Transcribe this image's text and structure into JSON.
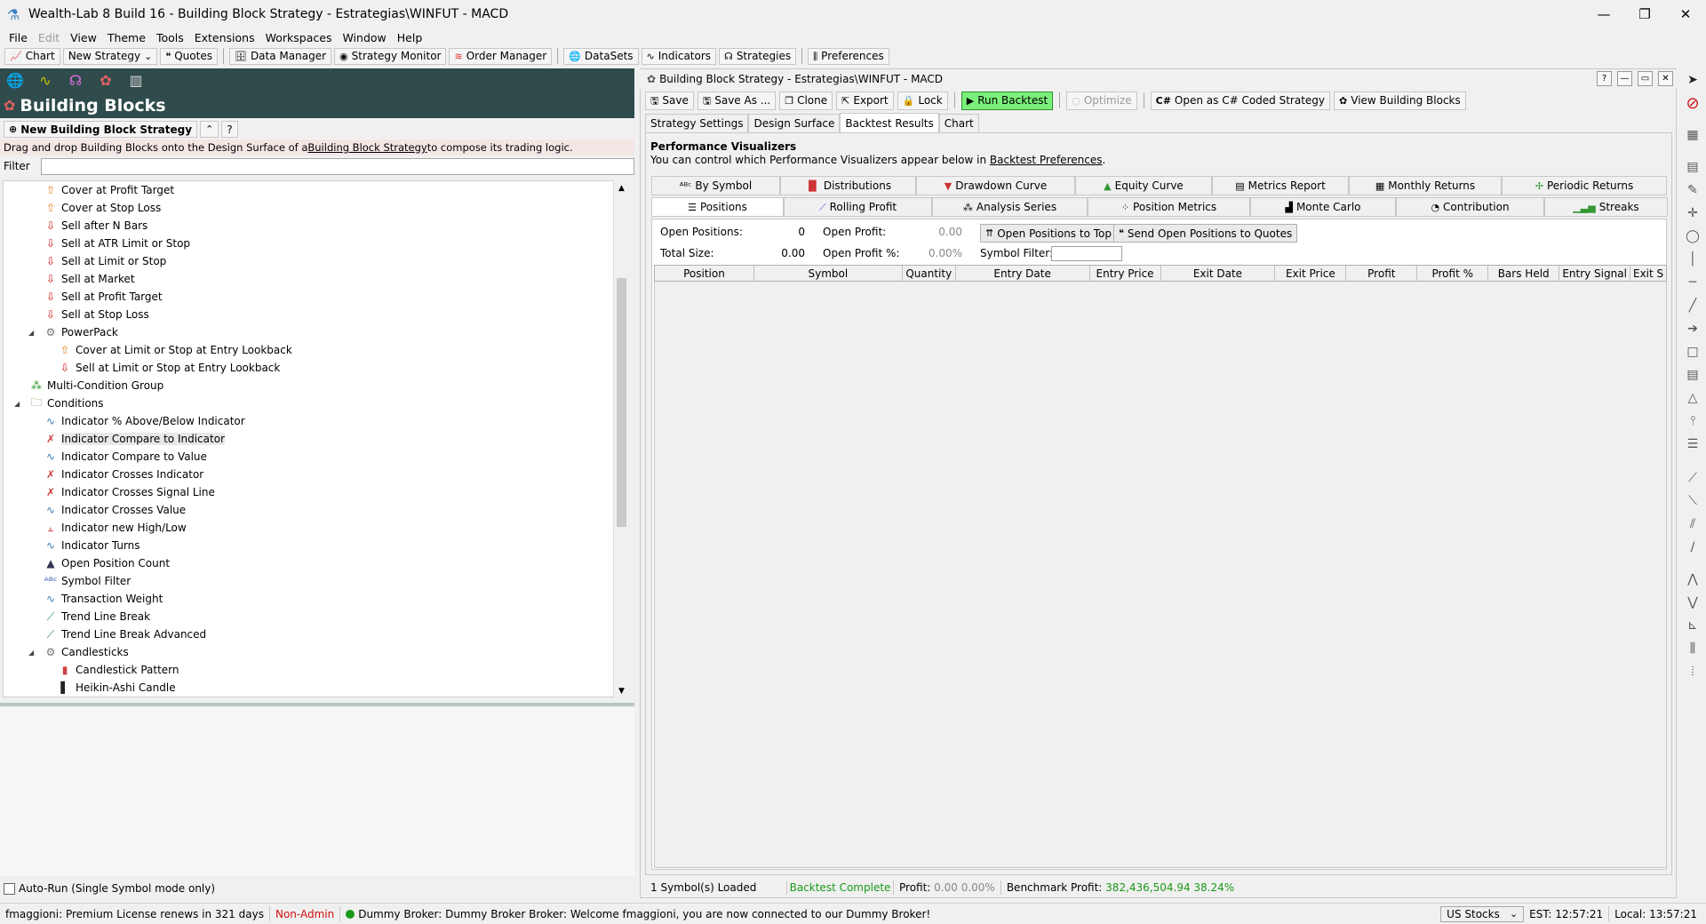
{
  "window": {
    "title": "Wealth-Lab 8 Build 16 - Building Block Strategy - Estrategias\\WINFUT - MACD"
  },
  "menu": [
    "File",
    "Edit",
    "View",
    "Theme",
    "Tools",
    "Extensions",
    "Workspaces",
    "Window",
    "Help"
  ],
  "toolbar": {
    "chart": "Chart",
    "new_strategy": "New Strategy",
    "quotes": "Quotes",
    "data_manager": "Data Manager",
    "strategy_monitor": "Strategy Monitor",
    "order_manager": "Order Manager",
    "datasets": "DataSets",
    "indicators": "Indicators",
    "strategies": "Strategies",
    "preferences": "Preferences"
  },
  "left": {
    "header": "Building Blocks",
    "new_button": "New Building Block Strategy",
    "help_button": "?",
    "description_pre": "Drag and drop Building Blocks onto the Design Surface of a ",
    "description_link": "Building Block Strategy",
    "description_post": " to compose its trading logic.",
    "filter_label": "Filter",
    "autorun": "Auto-Run (Single Symbol mode only)",
    "tree": [
      {
        "label": "Cover at Profit Target",
        "icon": "up-arrow-icon",
        "indent": 1
      },
      {
        "label": "Cover at Stop Loss",
        "icon": "up-arrow-icon",
        "indent": 1
      },
      {
        "label": "Sell after N Bars",
        "icon": "down-arrow-icon",
        "indent": 1
      },
      {
        "label": "Sell at ATR Limit or Stop",
        "icon": "down-arrow-icon",
        "indent": 1
      },
      {
        "label": "Sell at Limit or Stop",
        "icon": "down-arrow-icon",
        "indent": 1
      },
      {
        "label": "Sell at Market",
        "icon": "down-arrow-icon",
        "indent": 1
      },
      {
        "label": "Sell at Profit Target",
        "icon": "down-arrow-icon",
        "indent": 1
      },
      {
        "label": "Sell at Stop Loss",
        "icon": "down-arrow-icon",
        "indent": 1
      },
      {
        "label": "PowerPack",
        "icon": "gear-icon",
        "indent": 1,
        "expander": true
      },
      {
        "label": "Cover at Limit or Stop at Entry Lookback",
        "icon": "up-arrow-icon",
        "indent": 2
      },
      {
        "label": "Sell at Limit or Stop at Entry Lookback",
        "icon": "down-arrow-icon",
        "indent": 2
      },
      {
        "label": "Multi-Condition Group",
        "icon": "group-icon",
        "indent": 0
      },
      {
        "label": "Conditions",
        "icon": "folder-icon",
        "indent": 0,
        "expander": true
      },
      {
        "label": "Indicator % Above/Below Indicator",
        "icon": "wave-icon",
        "indent": 1
      },
      {
        "label": "Indicator Compare to Indicator",
        "icon": "cross-wave-icon",
        "indent": 1,
        "selected": true
      },
      {
        "label": "Indicator Compare to Value",
        "icon": "wave-icon",
        "indent": 1
      },
      {
        "label": "Indicator Crosses Indicator",
        "icon": "cross-wave-icon",
        "indent": 1
      },
      {
        "label": "Indicator Crosses Signal Line",
        "icon": "cross-wave-icon",
        "indent": 1
      },
      {
        "label": "Indicator Crosses Value",
        "icon": "wave-icon",
        "indent": 1
      },
      {
        "label": "Indicator new High/Low",
        "icon": "high-low-icon",
        "indent": 1
      },
      {
        "label": "Indicator Turns",
        "icon": "wave-icon",
        "indent": 1
      },
      {
        "label": "Open Position Count",
        "icon": "count-icon",
        "indent": 1
      },
      {
        "label": "Symbol Filter",
        "icon": "abc-icon",
        "indent": 1
      },
      {
        "label": "Transaction Weight",
        "icon": "wave-icon",
        "indent": 1
      },
      {
        "label": "Trend Line Break",
        "icon": "trendline-icon",
        "indent": 1
      },
      {
        "label": "Trend Line Break Advanced",
        "icon": "trendline-icon",
        "indent": 1
      },
      {
        "label": "Candlesticks",
        "icon": "gear-icon",
        "indent": 1,
        "expander": true
      },
      {
        "label": "Candlestick Pattern",
        "icon": "candle-icon",
        "indent": 2
      },
      {
        "label": "Heikin-Ashi Candle",
        "icon": "bars-icon",
        "indent": 2
      }
    ]
  },
  "right": {
    "title": "Building Block Strategy - Estrategias\\WINFUT - MACD",
    "buttons": {
      "save": "Save",
      "save_as": "Save As ...",
      "clone": "Clone",
      "export": "Export",
      "lock": "Lock",
      "run": "Run Backtest",
      "optimize": "Optimize",
      "open_cs": "Open as C# Coded Strategy",
      "view_bb": "View Building Blocks"
    },
    "tabs": [
      "Strategy Settings",
      "Design Surface",
      "Backtest Results",
      "Chart"
    ],
    "active_tab": "Backtest Results",
    "pv_title": "Performance Visualizers",
    "pv_sub_pre": "You can control which Performance Visualizers appear below in ",
    "pv_sub_link": "Backtest Preferences",
    "pv_sub_post": ".",
    "vtabs_row1": [
      "By Symbol",
      "Distributions",
      "Drawdown Curve",
      "Equity Curve",
      "Metrics Report",
      "Monthly Returns",
      "Periodic Returns"
    ],
    "vtabs_row2": [
      "Positions",
      "Rolling Profit",
      "Analysis Series",
      "Position Metrics",
      "Monte Carlo",
      "Contribution",
      "Streaks"
    ],
    "positions": {
      "open_positions_label": "Open Positions:",
      "open_positions_value": "0",
      "open_profit_label": "Open Profit:",
      "open_profit_value": "0.00",
      "total_size_label": "Total Size:",
      "total_size_value": "0.00",
      "open_profit_pct_label": "Open Profit %:",
      "open_profit_pct_value": "0.00%",
      "symbol_filter_label": "Symbol Filter:",
      "btn_top": "Open Positions to Top",
      "btn_send": "Send Open Positions to Quotes",
      "columns": [
        "Position",
        "Symbol",
        "Quantity",
        "Entry Date",
        "Entry Price",
        "Exit Date",
        "Exit Price",
        "Profit",
        "Profit %",
        "Bars Held",
        "Entry Signal",
        "Exit S"
      ]
    },
    "status": {
      "loaded": "1 Symbol(s) Loaded",
      "complete": "Backtest Complete",
      "profit_label": "Profit:",
      "profit_value": "0.00 0.00%",
      "bench_label": "Benchmark Profit:",
      "bench_value": "382,436,504.94 38.24%"
    }
  },
  "statusbar": {
    "license": "fmaggioni: Premium License renews in 321 days",
    "admin": "Non-Admin",
    "broker": "Dummy Broker: Dummy Broker Broker: Welcome fmaggioni, you are now connected to our Dummy Broker!",
    "market": "US Stocks",
    "est": "EST: 12:57:21",
    "local": "Local: 13:57:21"
  },
  "colors": {
    "accent_dark": "#2f4b4b",
    "run_green": "#7aef7a",
    "status_green": "#1a9a1a",
    "non_admin_red": "#d01010"
  }
}
